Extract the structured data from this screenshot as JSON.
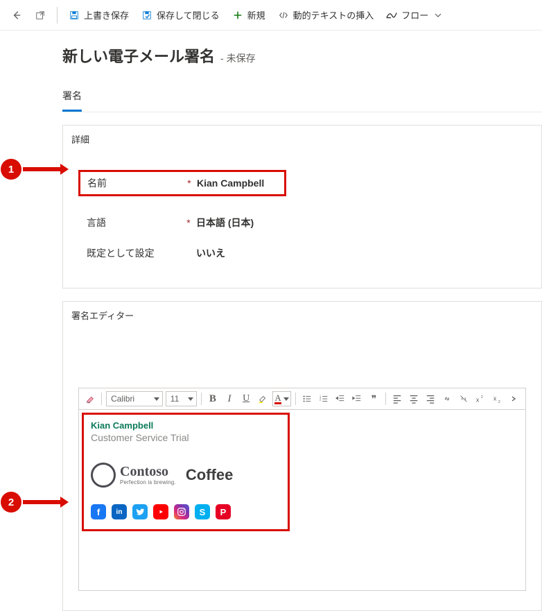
{
  "topbar": {
    "save": "上書き保存",
    "save_close": "保存して閉じる",
    "new": "新規",
    "dynamic_text": "動的テキストの挿入",
    "flow": "フロー"
  },
  "page": {
    "title": "新しい電子メール署名",
    "subtitle": "- 未保存"
  },
  "tabs": {
    "signature": "署名"
  },
  "callouts": {
    "one": "1",
    "two": "2"
  },
  "details": {
    "header": "詳細",
    "name_label": "名前",
    "name_value": "Kian Campbell",
    "lang_label": "言語",
    "lang_value": "日本語 (日本)",
    "default_label": "既定として設定",
    "default_value": "いいえ",
    "required": "*"
  },
  "editor": {
    "header": "署名エディター",
    "font": "Calibri",
    "size": "11",
    "bold": "B",
    "italic": "I",
    "underline": "U",
    "fontcolor_letter": "A",
    "quote": "❞"
  },
  "signature_preview": {
    "name": "Kian Campbell",
    "role": "Customer Service Trial",
    "logo_main": "Contoso",
    "logo_sub": "Perfection is brewing.",
    "coffee": "Coffee",
    "social": {
      "fb": "f",
      "li": "in",
      "tw": "",
      "yt": "",
      "ig": "",
      "sk": "S",
      "pt": "P"
    }
  }
}
